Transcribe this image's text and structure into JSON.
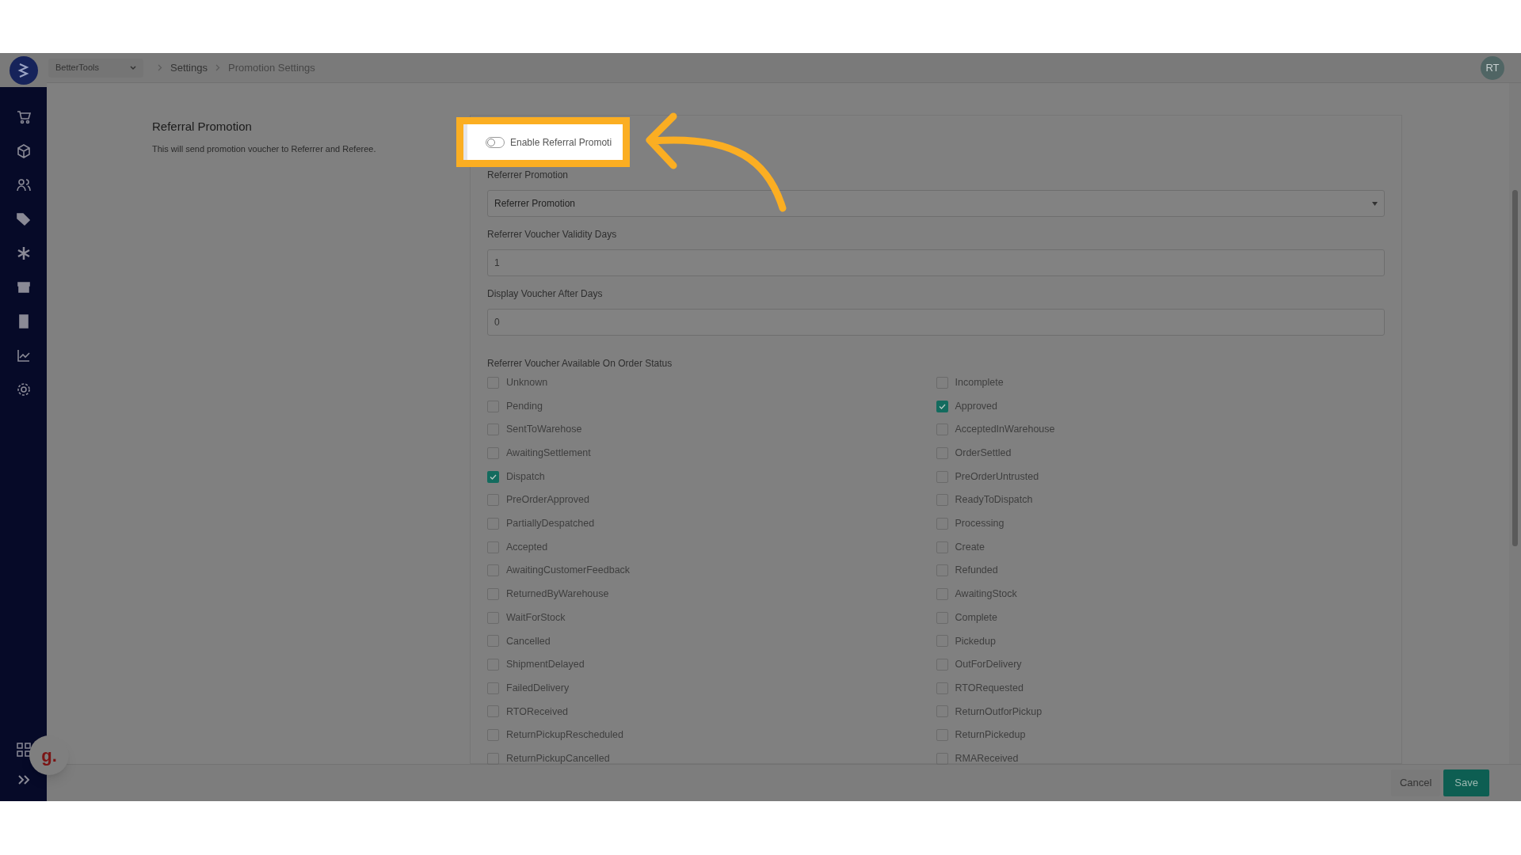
{
  "top_bar": {
    "workspace": "BetterTools",
    "breadcrumbs": [
      "Settings",
      "Promotion Settings"
    ],
    "avatar": "RT"
  },
  "section": {
    "title": "Referral Promotion",
    "description": "This will send promotion voucher to Referrer and Referee."
  },
  "toggle": {
    "label": "Enable Referral Promoti",
    "on": false
  },
  "fields": [
    {
      "kind": "select",
      "label": "Referrer Promotion",
      "value": "Referrer Promotion"
    },
    {
      "kind": "input",
      "label": "Referrer Voucher Validity Days",
      "value": "1"
    },
    {
      "kind": "input",
      "label": "Display Voucher After Days",
      "value": "0"
    }
  ],
  "status_group": {
    "label": "Referrer Voucher Available On Order Status",
    "options": [
      {
        "label": "Unknown",
        "checked": false
      },
      {
        "label": "Incomplete",
        "checked": false
      },
      {
        "label": "Pending",
        "checked": false
      },
      {
        "label": "Approved",
        "checked": true
      },
      {
        "label": "SentToWarehose",
        "checked": false
      },
      {
        "label": "AcceptedInWarehouse",
        "checked": false
      },
      {
        "label": "AwaitingSettlement",
        "checked": false
      },
      {
        "label": "OrderSettled",
        "checked": false
      },
      {
        "label": "Dispatch",
        "checked": true
      },
      {
        "label": "PreOrderUntrusted",
        "checked": false
      },
      {
        "label": "PreOrderApproved",
        "checked": false
      },
      {
        "label": "ReadyToDispatch",
        "checked": false
      },
      {
        "label": "PartiallyDespatched",
        "checked": false
      },
      {
        "label": "Processing",
        "checked": false
      },
      {
        "label": "Accepted",
        "checked": false
      },
      {
        "label": "Create",
        "checked": false
      },
      {
        "label": "AwaitingCustomerFeedback",
        "checked": false
      },
      {
        "label": "Refunded",
        "checked": false
      },
      {
        "label": "ReturnedByWarehouse",
        "checked": false
      },
      {
        "label": "AwaitingStock",
        "checked": false
      },
      {
        "label": "WaitForStock",
        "checked": false
      },
      {
        "label": "Complete",
        "checked": false
      },
      {
        "label": "Cancelled",
        "checked": false
      },
      {
        "label": "Pickedup",
        "checked": false
      },
      {
        "label": "ShipmentDelayed",
        "checked": false
      },
      {
        "label": "OutForDelivery",
        "checked": false
      },
      {
        "label": "FailedDelivery",
        "checked": false
      },
      {
        "label": "RTORequested",
        "checked": false
      },
      {
        "label": "RTOReceived",
        "checked": false
      },
      {
        "label": "ReturnOutforPickup",
        "checked": false
      },
      {
        "label": "ReturnPickupRescheduled",
        "checked": false
      },
      {
        "label": "ReturnPickedup",
        "checked": false
      },
      {
        "label": "ReturnPickupCancelled",
        "checked": false
      },
      {
        "label": "RMAReceived",
        "checked": false
      }
    ]
  },
  "footer": {
    "buttons": [
      {
        "kind": "secondary",
        "label": "Cancel"
      },
      {
        "kind": "primary",
        "label": "Save"
      }
    ]
  },
  "help_bubble": {
    "label": "g."
  }
}
